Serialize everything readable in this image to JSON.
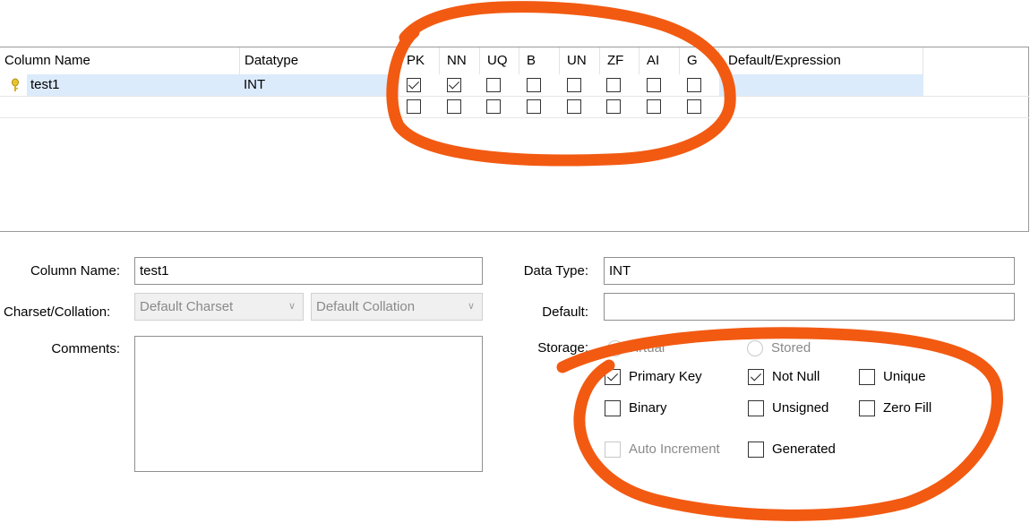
{
  "grid": {
    "columns": [
      {
        "key": "column_name",
        "label": "Column Name"
      },
      {
        "key": "datatype",
        "label": "Datatype"
      },
      {
        "key": "pk",
        "label": "PK"
      },
      {
        "key": "nn",
        "label": "NN"
      },
      {
        "key": "uq",
        "label": "UQ"
      },
      {
        "key": "b",
        "label": "B"
      },
      {
        "key": "un",
        "label": "UN"
      },
      {
        "key": "zf",
        "label": "ZF"
      },
      {
        "key": "ai",
        "label": "AI"
      },
      {
        "key": "g",
        "label": "G"
      },
      {
        "key": "default",
        "label": "Default/Expression"
      }
    ],
    "rows": [
      {
        "column_name": "test1",
        "datatype": "INT",
        "flags": [
          true,
          true,
          false,
          false,
          false,
          false,
          false,
          false
        ],
        "default": ""
      },
      {
        "column_name": "",
        "datatype": "",
        "flags": [
          false,
          false,
          false,
          false,
          false,
          false,
          false,
          false
        ],
        "default": ""
      }
    ]
  },
  "form": {
    "column_name_label": "Column Name:",
    "column_name_value": "test1",
    "charset_label": "Charset/Collation:",
    "charset_value": "Default Charset",
    "collation_value": "Default Collation",
    "comments_label": "Comments:",
    "comments_value": "",
    "data_type_label": "Data Type:",
    "data_type_value": "INT",
    "default_label": "Default:",
    "default_value": "",
    "storage_label": "Storage:",
    "storage_virtual": "Virtual",
    "storage_stored": "Stored",
    "options": {
      "primary_key": {
        "label": "Primary Key",
        "checked": true
      },
      "not_null": {
        "label": "Not Null",
        "checked": true
      },
      "unique": {
        "label": "Unique",
        "checked": false
      },
      "binary": {
        "label": "Binary",
        "checked": false
      },
      "unsigned": {
        "label": "Unsigned",
        "checked": false
      },
      "zero_fill": {
        "label": "Zero Fill",
        "checked": false
      },
      "auto_increment": {
        "label": "Auto Increment",
        "checked": false
      },
      "generated": {
        "label": "Generated",
        "checked": false
      }
    }
  },
  "annotation_color": "#f25a12",
  "icons": {
    "primary_key": "key-icon",
    "dropdown": "chevron-down-icon"
  }
}
